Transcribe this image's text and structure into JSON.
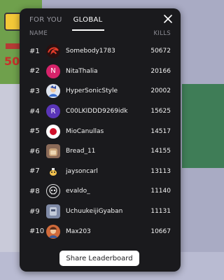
{
  "tabs": [
    {
      "label": "FOR YOU",
      "active": false
    },
    {
      "label": "GLOBAL",
      "active": true
    }
  ],
  "columns": {
    "name": "NAME",
    "kills": "KILLS"
  },
  "rows": [
    {
      "rank": "#1",
      "name": "Somebody1783",
      "kills": "50672",
      "avatar": "red-swirl-icon",
      "avatar_color": "#2a1010"
    },
    {
      "rank": "#2",
      "name": "NitaThalia",
      "kills": "20166",
      "avatar": "letter-N",
      "avatar_letter": "N",
      "avatar_color": "#d6236a"
    },
    {
      "rank": "#3",
      "name": "HyperSonicStyle",
      "kills": "20002",
      "avatar": "character-icon",
      "avatar_color": "#dfe4ee"
    },
    {
      "rank": "#4",
      "name": "C00LKIDDD9269idk",
      "kills": "15625",
      "avatar": "letter-R",
      "avatar_letter": "R",
      "avatar_color": "#5a35b8"
    },
    {
      "rank": "#5",
      "name": "MioCanullas",
      "kills": "14517",
      "avatar": "japan-flag-icon",
      "avatar_color": "#ffffff"
    },
    {
      "rank": "#6",
      "name": "Bread_11",
      "kills": "14155",
      "avatar": "bread-icon",
      "avatar_color": "#8a6a58"
    },
    {
      "rank": "#7",
      "name": "jaysoncarl",
      "kills": "13113",
      "avatar": "small-creature-icon",
      "avatar_color": "#1a1a1d"
    },
    {
      "rank": "#8",
      "name": "evaldo_",
      "kills": "11140",
      "avatar": "skull-icon",
      "avatar_color": "#1a1a1d"
    },
    {
      "rank": "#9",
      "name": "UchuukeijiGyaban",
      "kills": "11131",
      "avatar": "armor-icon",
      "avatar_color": "#7f8aa6"
    },
    {
      "rank": "#10",
      "name": "Max203",
      "kills": "10667",
      "avatar": "character-icon",
      "avatar_color": "#d06a3a"
    }
  ],
  "share_button": "Share Leaderboard",
  "background": {
    "hud_text": "50"
  }
}
